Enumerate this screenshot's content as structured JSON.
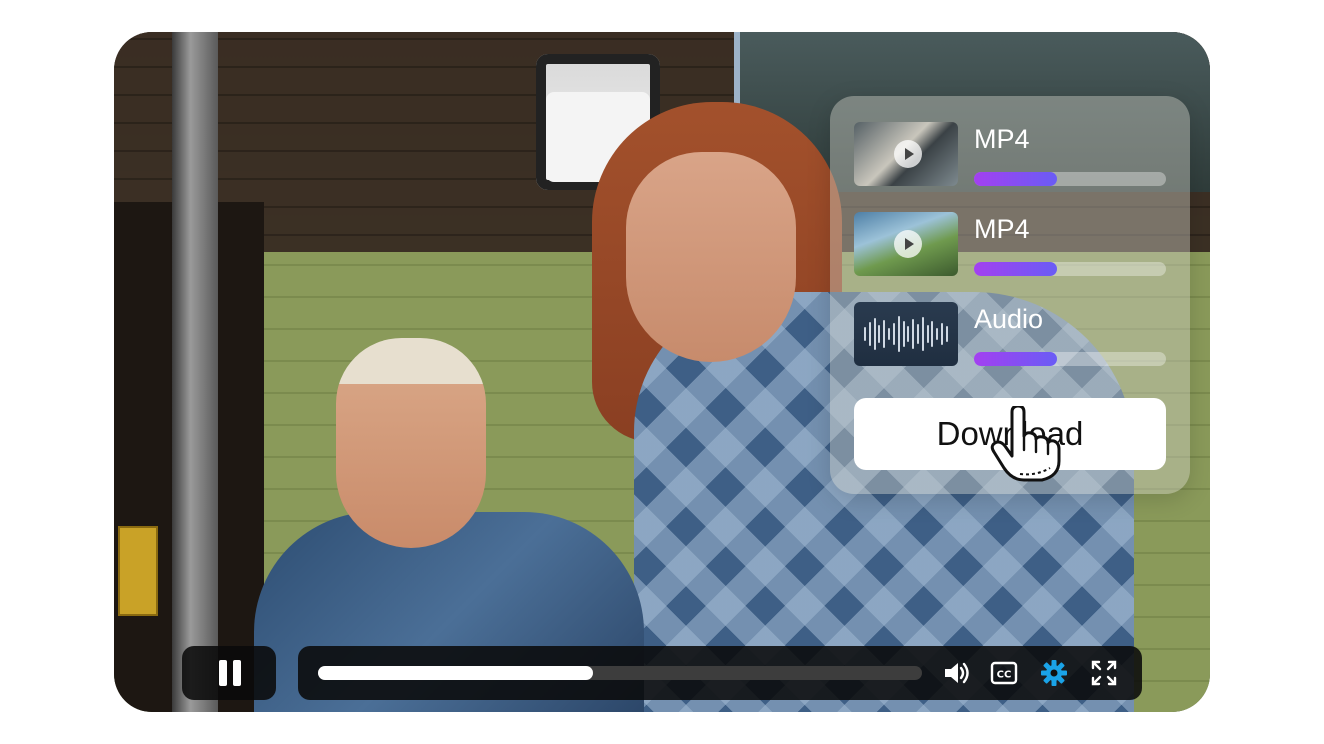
{
  "downloads": [
    {
      "label": "MP4",
      "kind": "video",
      "progress": 0.43
    },
    {
      "label": "MP4",
      "kind": "video",
      "progress": 0.43
    },
    {
      "label": "Audio",
      "kind": "audio",
      "progress": 0.43
    }
  ],
  "download_button": {
    "label": "Download"
  },
  "player": {
    "playback_progress": 0.455,
    "icons": [
      "pause-icon",
      "volume-icon",
      "closed-captions-icon",
      "settings-icon",
      "fullscreen-icon"
    ],
    "accent_color": "#1aa3e8",
    "cc_label": "CC"
  },
  "colors": {
    "progress_start": "#a340f0",
    "progress_end": "#6a5cf5"
  }
}
